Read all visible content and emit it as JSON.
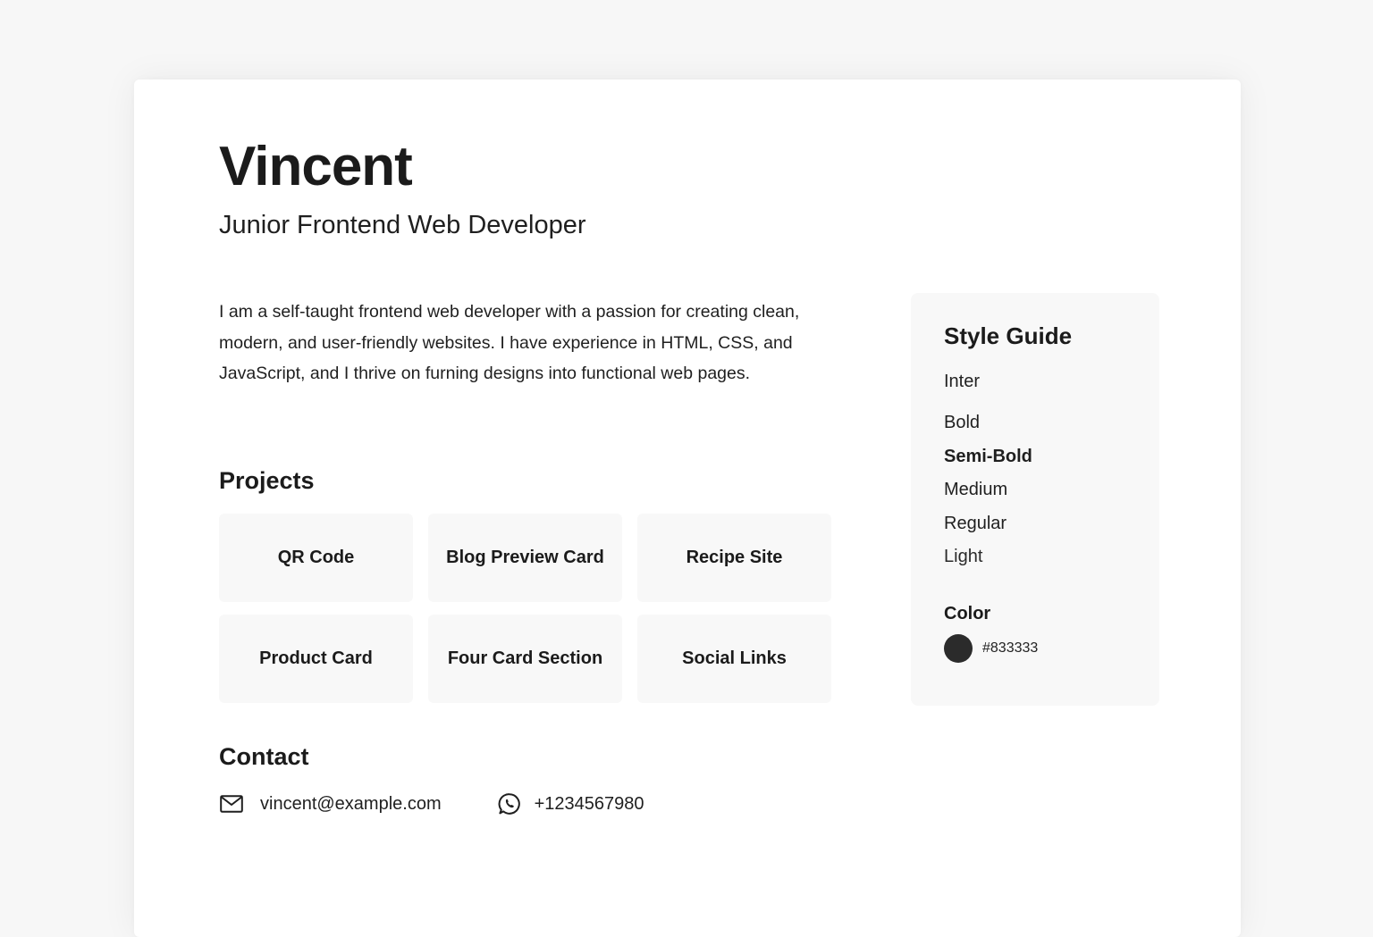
{
  "profile": {
    "name": "Vincent",
    "role": "Junior Frontend Web Developer",
    "bio": "I am a self-taught frontend web developer with a passion for creating clean, modern, and user-friendly websites. I have experience in HTML, CSS, and JavaScript, and I thrive on furning designs into functional web pages."
  },
  "projects": {
    "title": "Projects",
    "items": [
      {
        "label": "QR Code"
      },
      {
        "label": "Blog Preview Card"
      },
      {
        "label": "Recipe Site"
      },
      {
        "label": "Product Card"
      },
      {
        "label": "Four Card Section"
      },
      {
        "label": "Social Links"
      }
    ]
  },
  "contact": {
    "title": "Contact",
    "email": "vincent@example.com",
    "email_icon": "mail-icon",
    "phone": "+1234567980",
    "phone_icon": "whatsapp-icon"
  },
  "style_guide": {
    "title": "Style Guide",
    "font": "Inter",
    "weights": [
      "Bold",
      "Semi-Bold",
      "Medium",
      "Regular",
      "Light"
    ],
    "color_title": "Color",
    "color_hex": "#833333",
    "swatch_color": "#2b2b2b"
  },
  "theme": {
    "background": "#f7f7f7",
    "card": "#ffffff",
    "tile": "#f8f8f8",
    "text": "#1b1b1b"
  }
}
